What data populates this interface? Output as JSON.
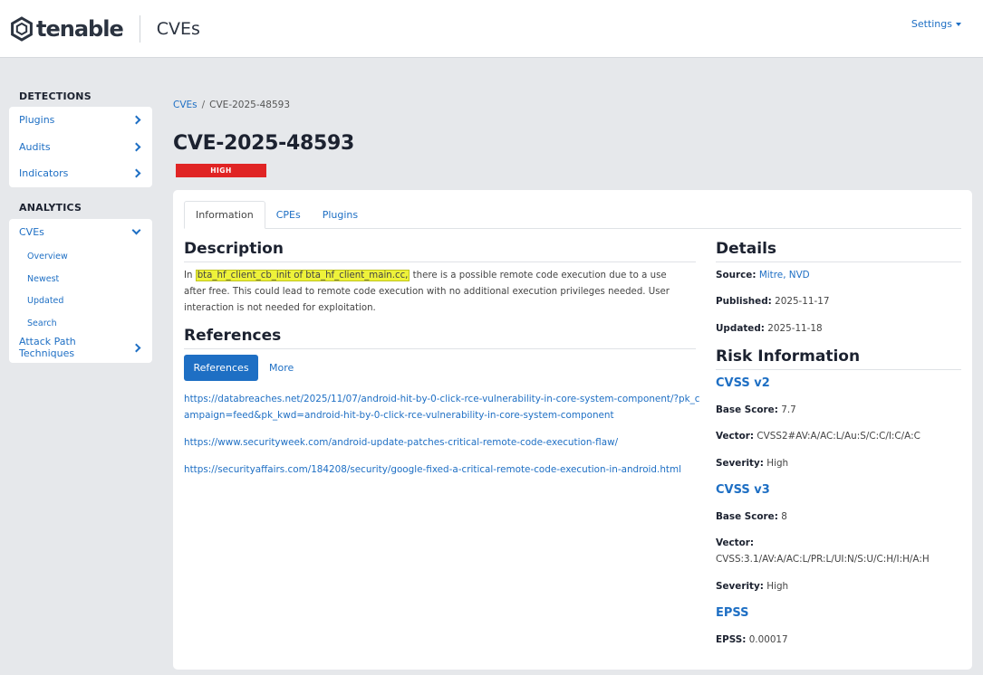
{
  "header": {
    "logo_text": "tenable",
    "app_title": "CVEs",
    "settings_label": "Settings"
  },
  "sidebar": {
    "detections_heading": "DETECTIONS",
    "detections": [
      {
        "label": "Plugins"
      },
      {
        "label": "Audits"
      },
      {
        "label": "Indicators"
      }
    ],
    "analytics_heading": "ANALYTICS",
    "analytics_parent": "CVEs",
    "analytics_sub": [
      {
        "label": "Overview"
      },
      {
        "label": "Newest"
      },
      {
        "label": "Updated"
      },
      {
        "label": "Search"
      }
    ],
    "attack_path": "Attack Path Techniques"
  },
  "breadcrumb": {
    "root": "CVEs",
    "separator": "/",
    "current": "CVE-2025-48593"
  },
  "page": {
    "title": "CVE-2025-48593",
    "severity_badge": "HIGH",
    "severity_color": "#e02424"
  },
  "tabs": [
    {
      "label": "Information",
      "active": true
    },
    {
      "label": "CPEs",
      "active": false
    },
    {
      "label": "Plugins",
      "active": false
    }
  ],
  "description": {
    "heading": "Description",
    "prefix": "In ",
    "highlight": "bta_hf_client_cb_init of bta_hf_client_main.cc,",
    "rest": " there is a possible remote code execution due to a use after free. This could lead to remote code execution with no additional execution privileges needed. User interaction is not needed for exploitation."
  },
  "references": {
    "heading": "References",
    "primary_button": "References",
    "more_button": "More",
    "links": [
      "https://databreaches.net/2025/11/07/android-hit-by-0-click-rce-vulnerability-in-core-system-component/?pk_campaign=feed&pk_kwd=android-hit-by-0-click-rce-vulnerability-in-core-system-component",
      "https://www.securityweek.com/android-update-patches-critical-remote-code-execution-flaw/",
      "https://securityaffairs.com/184208/security/google-fixed-a-critical-remote-code-execution-in-android.html"
    ]
  },
  "details": {
    "heading": "Details",
    "source_label": "Source:",
    "source_value": "Mitre, NVD",
    "published_label": "Published:",
    "published_value": "2025-11-17",
    "updated_label": "Updated:",
    "updated_value": "2025-11-18"
  },
  "risk": {
    "heading": "Risk Information",
    "cvss2": {
      "heading": "CVSS v2",
      "base_label": "Base Score:",
      "base_value": "7.7",
      "vector_label": "Vector:",
      "vector_value": "CVSS2#AV:A/AC:L/Au:S/C:C/I:C/A:C",
      "severity_label": "Severity:",
      "severity_value": "High"
    },
    "cvss3": {
      "heading": "CVSS v3",
      "base_label": "Base Score:",
      "base_value": "8",
      "vector_label": "Vector:",
      "vector_value": "CVSS:3.1/AV:A/AC:L/PR:L/UI:N/S:U/C:H/I:H/A:H",
      "severity_label": "Severity:",
      "severity_value": "High"
    },
    "epss": {
      "heading": "EPSS",
      "label": "EPSS:",
      "value": "0.00017"
    }
  }
}
